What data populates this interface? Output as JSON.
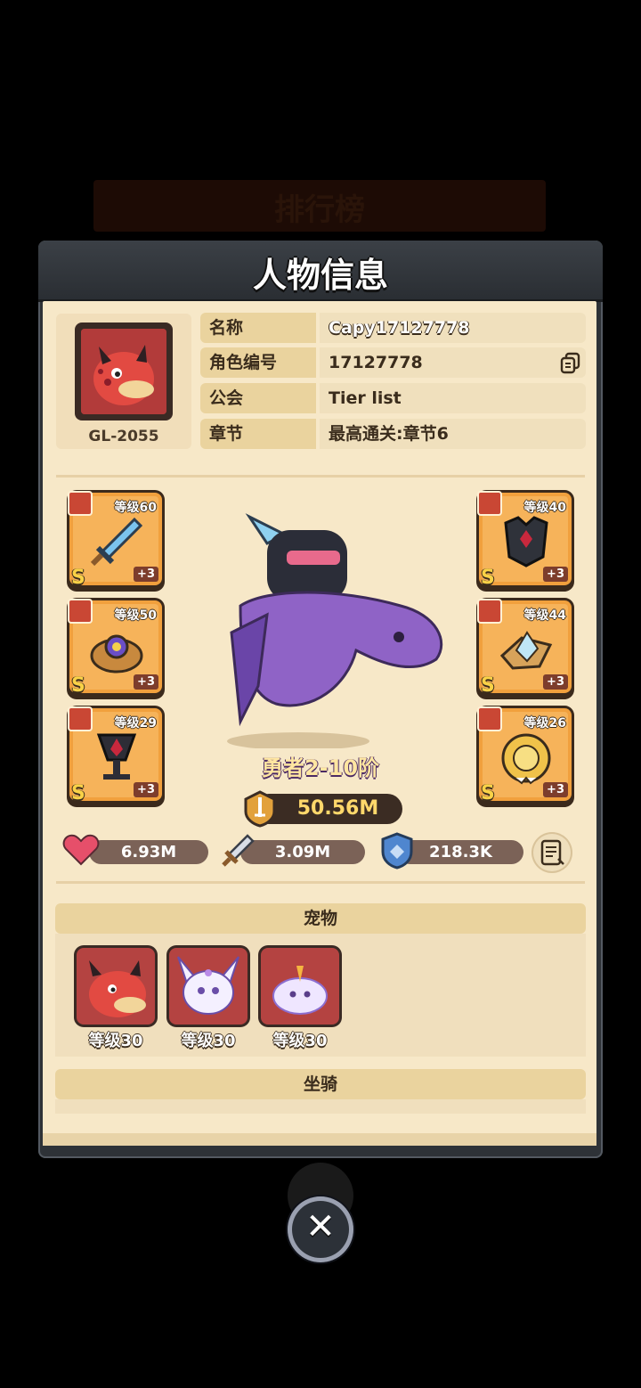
{
  "background": {
    "banner_title": "排行榜"
  },
  "dialog": {
    "title": "人物信息",
    "avatar_code": "GL-2055",
    "info": [
      {
        "key": "名称",
        "value": "Capy17127778"
      },
      {
        "key": "角色编号",
        "value": "17127778"
      },
      {
        "key": "公会",
        "value": "Tier list"
      },
      {
        "key": "章节",
        "value": "最高通关:章节6"
      }
    ],
    "equipment_left": [
      {
        "slot": "weapon",
        "level": "等级60",
        "tier": "S",
        "plus": "+3",
        "icon": "sword-icon"
      },
      {
        "slot": "helmet",
        "level": "等级50",
        "tier": "S",
        "plus": "+3",
        "icon": "ring-icon"
      },
      {
        "slot": "necklace",
        "level": "等级29",
        "tier": "S",
        "plus": "+3",
        "icon": "goblet-icon"
      }
    ],
    "equipment_right": [
      {
        "slot": "armor",
        "level": "等级40",
        "tier": "S",
        "plus": "+3",
        "icon": "armor-icon"
      },
      {
        "slot": "belt",
        "level": "等级44",
        "tier": "S",
        "plus": "+3",
        "icon": "crystal-icon"
      },
      {
        "slot": "medal",
        "level": "等级26",
        "tier": "S",
        "plus": "+3",
        "icon": "medal-icon"
      }
    ],
    "hero_title": "勇者2-10阶",
    "power": "50.56M",
    "stats": {
      "hp": "6.93M",
      "attack": "3.09M",
      "defense": "218.3K"
    },
    "pets_title": "宠物",
    "pets": [
      {
        "level": "等级30",
        "icon": "red-dragon-icon"
      },
      {
        "level": "等级30",
        "icon": "white-fox-icon"
      },
      {
        "level": "等级30",
        "icon": "unicorn-slime-icon"
      }
    ],
    "mount_title": "坐骑",
    "colors": {
      "accent": "#f1a03d",
      "paper": "#f7e8c8",
      "header": "#2e3237"
    }
  }
}
